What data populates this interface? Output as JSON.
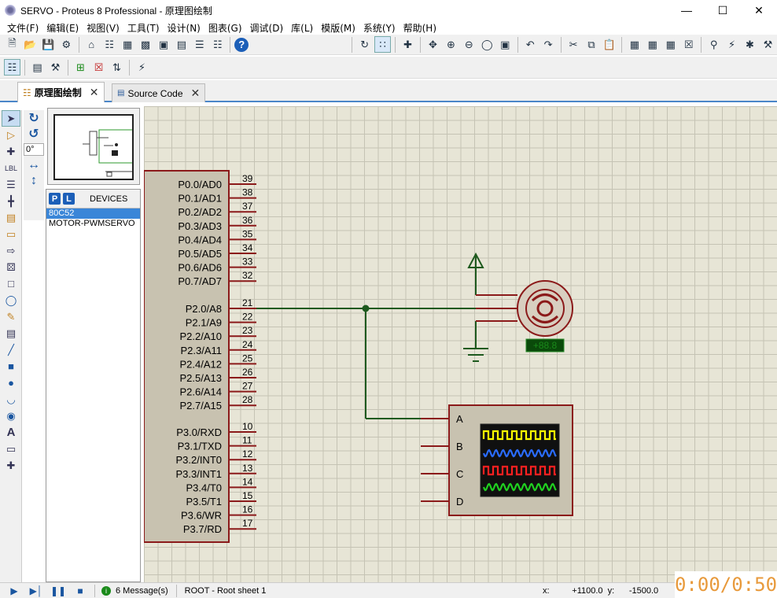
{
  "window": {
    "title": "SERVO - Proteus 8 Professional - 原理图绘制"
  },
  "menu": [
    "文件(F)",
    "编辑(E)",
    "视图(V)",
    "工具(T)",
    "设计(N)",
    "图表(G)",
    "调试(D)",
    "库(L)",
    "模版(M)",
    "系统(Y)",
    "帮助(H)"
  ],
  "tabs": [
    {
      "label": "原理图绘制",
      "close": "✕"
    },
    {
      "label": "Source Code",
      "close": "✕"
    }
  ],
  "rotation": {
    "value": "0°"
  },
  "devices": {
    "p_label": "P",
    "l_label": "L",
    "header": "DEVICES",
    "items": [
      "80C52",
      "MOTOR-PWMSERVO"
    ],
    "selected": "80C52"
  },
  "schematic": {
    "mcu": {
      "pins_left_top": [
        {
          "name": "P0.0/AD0",
          "num": "39"
        },
        {
          "name": "P0.1/AD1",
          "num": "38"
        },
        {
          "name": "P0.2/AD2",
          "num": "37"
        },
        {
          "name": "P0.3/AD3",
          "num": "36"
        },
        {
          "name": "P0.4/AD4",
          "num": "35"
        },
        {
          "name": "P0.5/AD5",
          "num": "34"
        },
        {
          "name": "P0.6/AD6",
          "num": "33"
        },
        {
          "name": "P0.7/AD7",
          "num": "32"
        }
      ],
      "pins_p2": [
        {
          "name": "P2.0/A8",
          "num": "21"
        },
        {
          "name": "P2.1/A9",
          "num": "22"
        },
        {
          "name": "P2.2/A10",
          "num": "23"
        },
        {
          "name": "P2.3/A11",
          "num": "24"
        },
        {
          "name": "P2.4/A12",
          "num": "25"
        },
        {
          "name": "P2.5/A13",
          "num": "26"
        },
        {
          "name": "P2.6/A14",
          "num": "27"
        },
        {
          "name": "P2.7/A15",
          "num": "28"
        }
      ],
      "pins_p3": [
        {
          "name": "P3.0/RXD",
          "num": "10"
        },
        {
          "name": "P3.1/TXD",
          "num": "11"
        },
        {
          "name": "P3.2/INT0",
          "num": "12"
        },
        {
          "name": "P3.3/INT1",
          "num": "13"
        },
        {
          "name": "P3.4/T0",
          "num": "14"
        },
        {
          "name": "P3.5/T1",
          "num": "15"
        },
        {
          "name": "P3.6/WR",
          "num": "16"
        },
        {
          "name": "P3.7/RD",
          "num": "17"
        }
      ]
    },
    "servo_display": "+88.8",
    "scope_channels": [
      "A",
      "B",
      "C",
      "D"
    ]
  },
  "colors": {
    "wire": "#1e5a1e",
    "pin": "#8b1a1a",
    "body": "#c8c2b0",
    "scope_a": "#ffff00",
    "scope_b": "#2a6cff",
    "scope_c": "#ff2020",
    "scope_d": "#20d020"
  },
  "status": {
    "messages": "6 Message(s)",
    "sheet": "ROOT - Root sheet 1",
    "x_label": "x:",
    "x_value": "+1100.0",
    "y_label": "y:",
    "y_value": "-1500.0"
  },
  "timer": "0:00/0:50"
}
